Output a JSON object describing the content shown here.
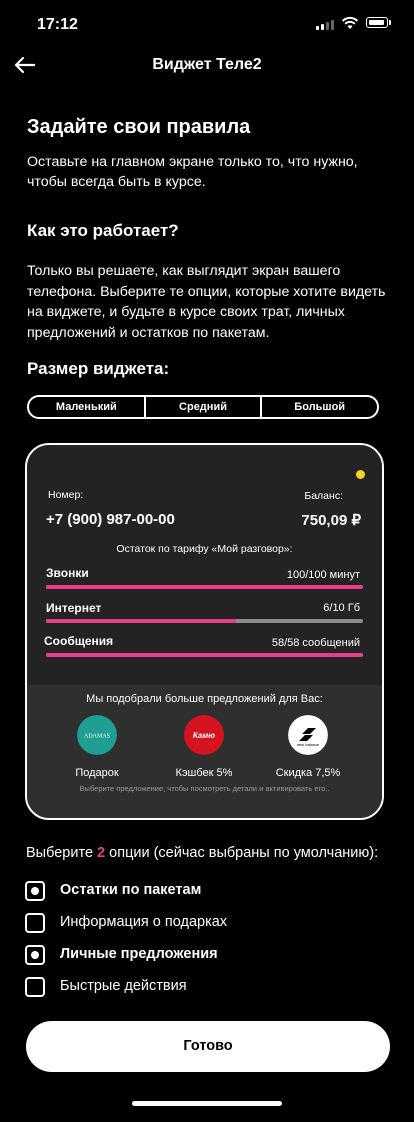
{
  "status_bar": {
    "time": "17:12"
  },
  "header": {
    "title": "Виджет Теле2"
  },
  "intro": {
    "title": "Задайте свои правила",
    "text": "Оставьте на главном экране только то, что нужно, чтобы всегда быть в курсе."
  },
  "how": {
    "title": "Как это работает?",
    "text": "Только вы решаете, как выглядит экран вашего телефона. Выберите те опции, которые хотите видеть на виджете, и будьте в курсе своих трат, личных предложений и  остатков по пакетам."
  },
  "size": {
    "title": "Размер виджета:",
    "options": [
      "Маленький",
      "Средний",
      "Большой"
    ]
  },
  "widget": {
    "number_label": "Номер:",
    "number": "+7 (900) 987-00-00",
    "balance_label": "Баланс:",
    "balance": "750,09 ₽",
    "tariff_text": "Остаток по тарифу «Мой разговор»:",
    "rows": [
      {
        "label": "Звонки",
        "value": "100/100 минут",
        "fill": 1.0
      },
      {
        "label": "Интернет",
        "value": "6/10 Гб",
        "fill": 0.6
      },
      {
        "label": "Сообщения",
        "value": "58/58 сообщений",
        "fill": 1.0
      }
    ],
    "offers_title": "Мы подобрали больше предложений для Вас:",
    "offers": [
      {
        "label": "Подарок",
        "logo_text": "ADAMAS",
        "color": "#1f9e93"
      },
      {
        "label": "Кэшбек 5%",
        "logo_text": "Камю",
        "color": "#d5131f"
      },
      {
        "label": "Скидка 7,5%",
        "logo_text": "new balance",
        "color": "#ffffff"
      }
    ],
    "hint": "Выберите предложение, чтобы посмотреть детали и активировать его.."
  },
  "choose": {
    "prefix": "Выберите",
    "count": "2",
    "suffix": "опции (сейчас выбраны по умолчанию):"
  },
  "options": [
    {
      "label": "Остатки по пакетам",
      "checked": true
    },
    {
      "label": "Информация о подарках",
      "checked": false
    },
    {
      "label": "Личные предложения",
      "checked": true
    },
    {
      "label": "Быстрые действия",
      "checked": false
    }
  ],
  "done_button": "Готово",
  "colors": {
    "accent": "#e63d8f",
    "indicator": "#f6d31c"
  }
}
